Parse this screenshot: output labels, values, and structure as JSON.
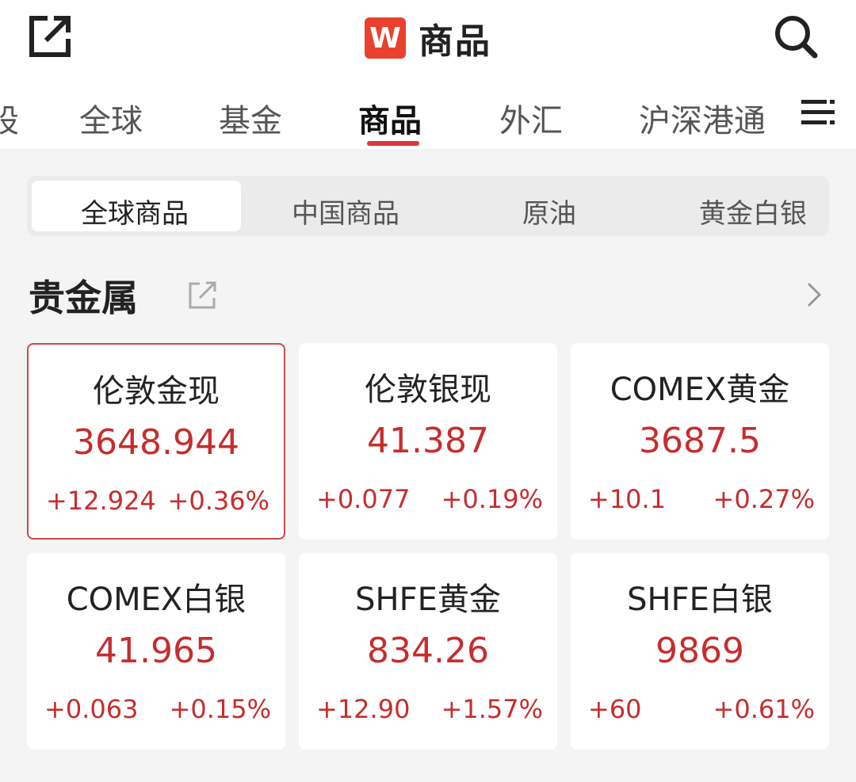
{
  "header": {
    "logo_letter": "W",
    "title": "商品"
  },
  "top_tabs": [
    {
      "label": "股"
    },
    {
      "label": "全球"
    },
    {
      "label": "基金"
    },
    {
      "label": "商品",
      "active": true
    },
    {
      "label": "外汇"
    },
    {
      "label": "沪深港通"
    }
  ],
  "sub_tabs": [
    {
      "label": "全球商品",
      "active": true
    },
    {
      "label": "中国商品"
    },
    {
      "label": "原油"
    },
    {
      "label": "黄金白银"
    }
  ],
  "section": {
    "title": "贵金属"
  },
  "cards": [
    {
      "name": "伦敦金现",
      "price": "3648.944",
      "change": "+12.924",
      "change_pct": "+0.36%",
      "selected": true
    },
    {
      "name": "伦敦银现",
      "price": "41.387",
      "change": "+0.077",
      "change_pct": "+0.19%"
    },
    {
      "name": "COMEX黄金",
      "price": "3687.5",
      "change": "+10.1",
      "change_pct": "+0.27%"
    },
    {
      "name": "COMEX白银",
      "price": "41.965",
      "change": "+0.063",
      "change_pct": "+0.15%"
    },
    {
      "name": "SHFE黄金",
      "price": "834.26",
      "change": "+12.90",
      "change_pct": "+1.57%"
    },
    {
      "name": "SHFE白银",
      "price": "9869",
      "change": "+60",
      "change_pct": "+0.61%"
    }
  ],
  "colors": {
    "up": "#c62d2d",
    "accent": "#d9383a",
    "logo": "#e8412d"
  }
}
